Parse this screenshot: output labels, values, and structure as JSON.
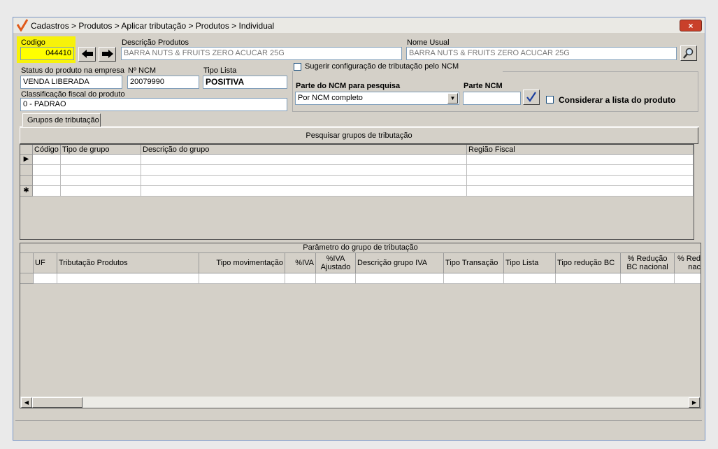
{
  "window": {
    "breadcrumb": "Cadastros > Produtos > Aplicar tributação > Produtos > Individual",
    "close_label": "×"
  },
  "form": {
    "codigo_label": "Codigo",
    "codigo_value": "044410",
    "descricao_label": "Descrição  Produtos",
    "descricao_value": "BARRA NUTS & FRUITS ZERO ACUCAR 25G",
    "nome_usual_label": "Nome Usual",
    "nome_usual_value": "BARRA NUTS & FRUITS ZERO ACUCAR 25G",
    "status_label": "Status do produto na empresa",
    "status_value": "VENDA LIBERADA",
    "ncm_label": "Nº NCM",
    "ncm_value": "20079990",
    "tipo_lista_label": "Tipo Lista",
    "tipo_lista_value": "POSITIVA",
    "classificacao_label": "Classificação fiscal do produto",
    "classificacao_value": "0 - PADRAO",
    "sugerir_label": "Sugerir configuração de tributação pelo NCM",
    "parte_ncm_pesquisa_label": "Parte do NCM para pesquisa",
    "parte_ncm_pesquisa_value": "Por NCM completo",
    "parte_ncm_label": "Parte NCM",
    "parte_ncm_value": "",
    "considerar_label": "Considerar a lista do produto"
  },
  "tabs": [
    "Grupos de tributação"
  ],
  "grupos": {
    "search_button": "Pesquisar grupos de tributação",
    "columns": [
      "Código",
      "Tipo de grupo",
      "Descrição do grupo",
      "Região Fiscal"
    ],
    "row_indicators": [
      "▶",
      "",
      "",
      "✱"
    ]
  },
  "parametros": {
    "title": "Parâmetro do grupo de tributação",
    "columns": [
      "UF",
      "Tributação Produtos",
      "Tipo movimentação",
      "%IVA",
      "%IVA Ajustado",
      "Descrição grupo IVA",
      "Tipo Transação",
      "Tipo Lista",
      "Tipo redução BC",
      "% Redução BC nacional",
      "% Red nac"
    ]
  },
  "icons": {
    "logo": "check-logo-icon",
    "prev": "arrow-left-icon",
    "next": "arrow-right-icon",
    "search": "magnifier-icon",
    "confirm": "checkmark-icon"
  },
  "colors": {
    "highlight": "#f7f20a",
    "accent": "#1c3fa0"
  }
}
